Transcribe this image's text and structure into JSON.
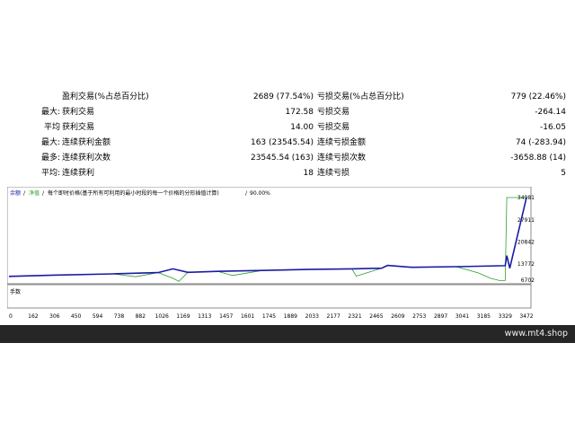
{
  "stats": {
    "rows": [
      {
        "prefix": "",
        "label": "盈利交易(%占总百分比)",
        "value": "2689 (77.54%)",
        "rlabel": "亏损交易(%占总百分比)",
        "rvalue": "779 (22.46%)"
      },
      {
        "prefix": "最大:",
        "label": "获利交易",
        "value": "172.58",
        "rlabel": "亏损交易",
        "rvalue": "-264.14"
      },
      {
        "prefix": "平均",
        "label": "获利交易",
        "value": "14.00",
        "rlabel": "亏损交易",
        "rvalue": "-16.05"
      },
      {
        "prefix": "最大:",
        "label": "连续获利金额",
        "value": "163 (23545.54)",
        "rlabel": "连续亏损金额",
        "rvalue": "74 (-283.94)"
      },
      {
        "prefix": "最多:",
        "label": "连续获利次数",
        "value": "23545.54 (163)",
        "rlabel": "连续亏损次数",
        "rvalue": "-3658.88 (14)"
      },
      {
        "prefix": "平均:",
        "label": "连续获利",
        "value": "18",
        "rlabel": "连续亏损",
        "rvalue": "5"
      }
    ]
  },
  "chart": {
    "legend_balance": "余额",
    "legend_equity": "净值",
    "legend_sep": "/",
    "legend_text": "每个即时价格(基于所有可利用的最小时段的每一个价格的分形插值计算)",
    "legend_quality": "90.00%",
    "lots_label": "手数"
  },
  "chart_data": {
    "type": "line",
    "x_ticks": [
      "0",
      "162",
      "306",
      "450",
      "594",
      "738",
      "882",
      "1026",
      "1169",
      "1313",
      "1457",
      "1601",
      "1745",
      "1889",
      "2033",
      "2177",
      "2321",
      "2465",
      "2609",
      "2753",
      "2897",
      "3041",
      "3185",
      "3329",
      "3472"
    ],
    "y_ticks": [
      "34981",
      "27911",
      "20842",
      "13772",
      "6702"
    ],
    "ylim": [
      6702,
      34981
    ],
    "xlim": [
      0,
      3472
    ],
    "series": [
      {
        "name": "余额",
        "color": "#1a1aa6",
        "x": [
          0,
          300,
          700,
          1000,
          1100,
          1200,
          1400,
          1700,
          2000,
          2300,
          2500,
          2540,
          2700,
          3000,
          3329,
          3340,
          3360,
          3472
        ],
        "y": [
          9900,
          10300,
          10700,
          11100,
          12300,
          11200,
          11500,
          11800,
          12100,
          12300,
          12500,
          13400,
          12800,
          13000,
          13300,
          16500,
          12500,
          34981
        ]
      },
      {
        "name": "净值",
        "color": "#2e9e2e",
        "x": [
          0,
          300,
          700,
          850,
          1000,
          1100,
          1140,
          1200,
          1400,
          1500,
          1700,
          2000,
          2300,
          2330,
          2500,
          2540,
          2700,
          3000,
          3150,
          3230,
          3290,
          3329,
          3340,
          3472
        ],
        "y": [
          9900,
          10300,
          10700,
          9800,
          11100,
          9300,
          8300,
          11200,
          11500,
          10200,
          11800,
          12100,
          12300,
          10000,
          12500,
          13400,
          12800,
          13000,
          11000,
          9300,
          8600,
          8600,
          34981,
          34981
        ]
      }
    ]
  },
  "footer": {
    "site": "www.mt4.shop"
  },
  "colors": {
    "balance": "#1a1aa6",
    "equity": "#2e9e2e",
    "axis": "#8c8c8c",
    "footer_bg": "#262626"
  }
}
